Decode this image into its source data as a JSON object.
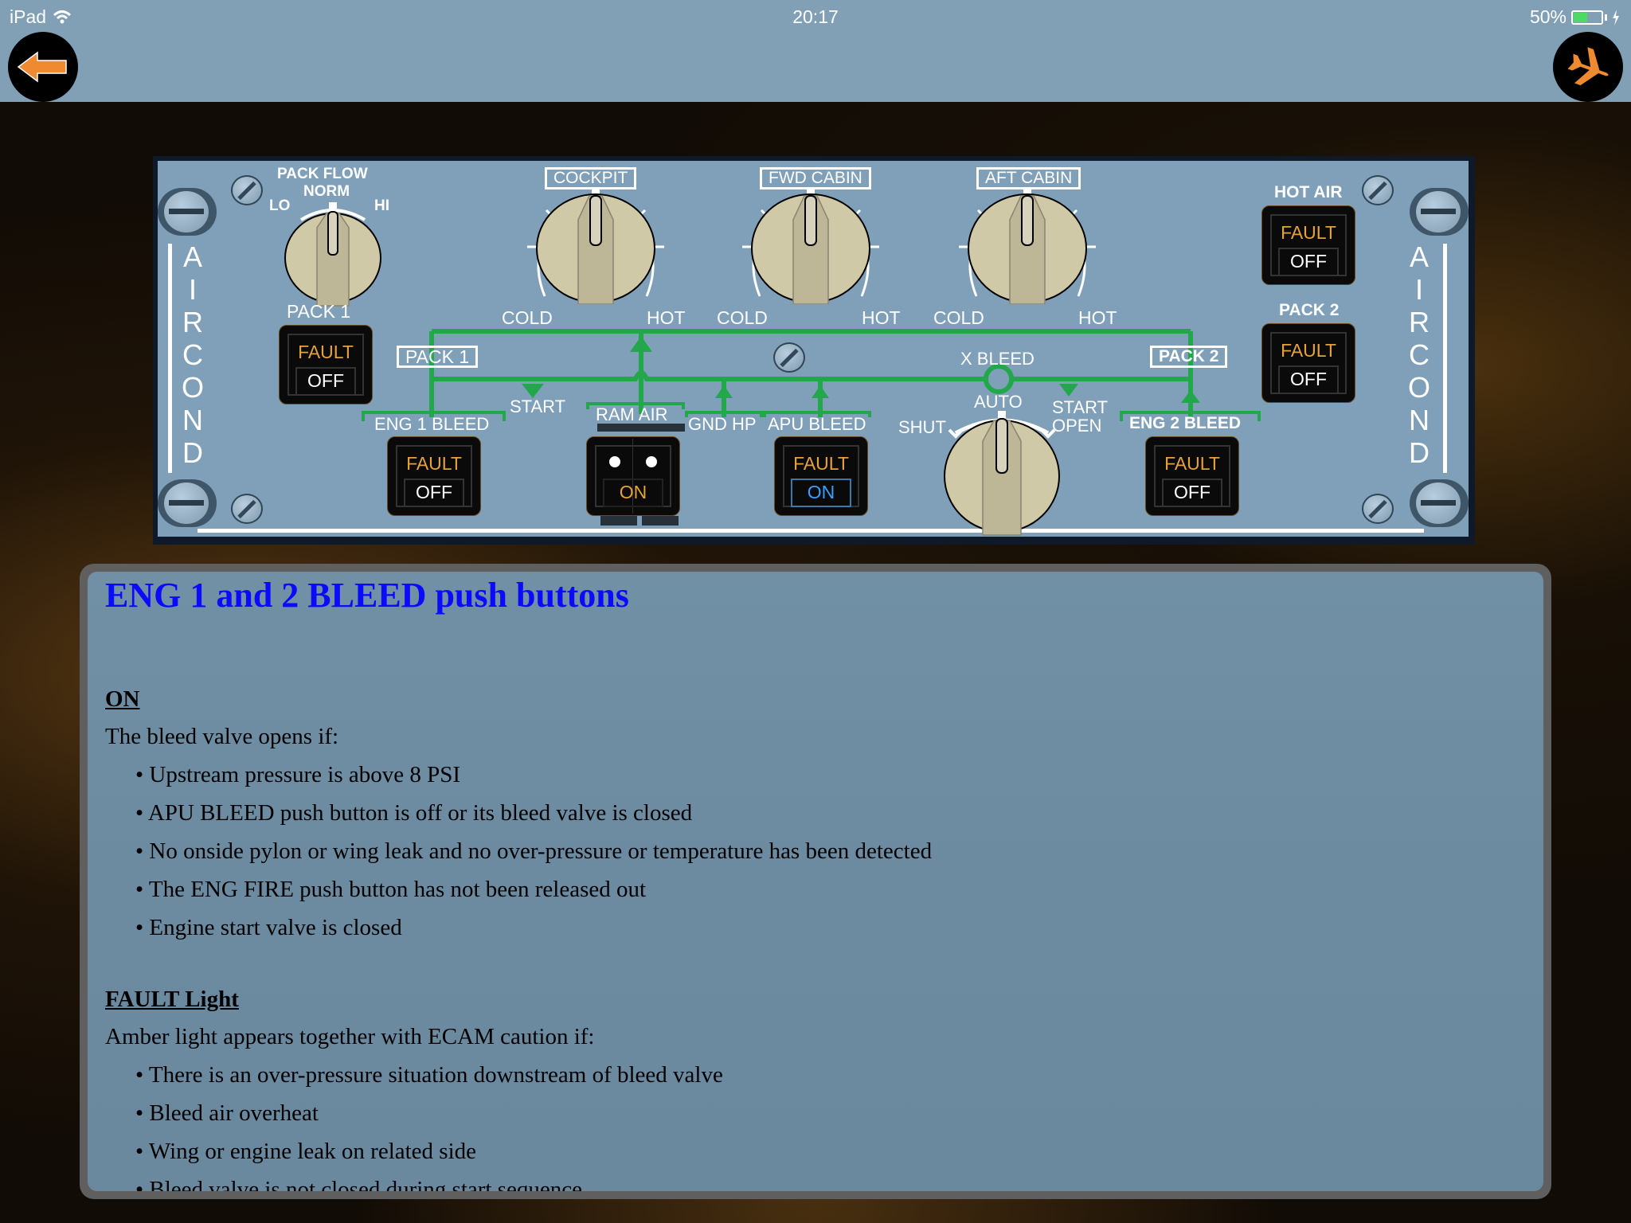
{
  "status_bar": {
    "device": "iPad",
    "time": "20:17",
    "battery": "50%",
    "battery_level": 0.5
  },
  "nav": {
    "back_icon": "back-arrow-icon",
    "home_icon": "airplane-icon"
  },
  "panel": {
    "side_label_left": [
      "A",
      "I",
      "R",
      "C",
      "O",
      "N",
      "D"
    ],
    "side_label_right": [
      "A",
      "I",
      "R",
      "C",
      "O",
      "N",
      "D"
    ],
    "pack_flow": {
      "title": "PACK FLOW",
      "norm": "NORM",
      "lo": "LO",
      "hi": "HI",
      "position": "NORM"
    },
    "pack1_label": "PACK 1",
    "pack2_label": "PACK 2",
    "hot_air_label": "HOT AIR",
    "temp_selectors": [
      {
        "label": "COCKPIT",
        "cold": "COLD",
        "hot": "HOT"
      },
      {
        "label": "FWD CABIN",
        "cold": "COLD",
        "hot": "HOT"
      },
      {
        "label": "AFT CABIN",
        "cold": "COLD",
        "hot": "HOT"
      }
    ],
    "duct_labels": {
      "pack1": "PACK 1",
      "pack2": "PACK 2",
      "start": "START",
      "ram_air": "RAM AIR",
      "gnd_hp": "GND HP",
      "apu_bleed": "APU BLEED",
      "eng1_bleed": "ENG 1 BLEED",
      "eng2_bleed": "ENG 2 BLEED",
      "x_bleed": "X BLEED"
    },
    "x_bleed_selector": {
      "shut": "SHUT",
      "auto": "AUTO",
      "open_line1": "START",
      "open_line2": "OPEN",
      "position": "AUTO"
    },
    "buttons": {
      "pack1": {
        "upper": "FAULT",
        "lower": "OFF"
      },
      "pack2": {
        "upper": "FAULT",
        "lower": "OFF"
      },
      "hot_air": {
        "upper": "FAULT",
        "lower": "OFF"
      },
      "eng1_bleed": {
        "upper": "FAULT",
        "lower": "OFF"
      },
      "eng2_bleed": {
        "upper": "FAULT",
        "lower": "OFF"
      },
      "apu_bleed": {
        "upper": "FAULT",
        "lower": "ON"
      },
      "ram_air": {
        "upper": "",
        "lower": "ON"
      }
    },
    "colors": {
      "panel": "#7fa0b8",
      "duct": "#22a84a",
      "fault": "#e6a23a",
      "on_blue": "#3aa0ff"
    }
  },
  "content": {
    "title": "ENG 1 and 2 BLEED push buttons",
    "sections": [
      {
        "heading": "ON",
        "intro": "The bleed valve opens if:",
        "bullets": [
          "Upstream pressure is above 8 PSI",
          "APU BLEED push button is off or its bleed valve is closed",
          "No onside pylon or wing leak and no over-pressure or temperature has been detected",
          "The ENG FIRE push button has not been released out",
          "Engine start valve is closed"
        ]
      },
      {
        "heading": "FAULT Light",
        "intro": "Amber light appears together with ECAM caution if:",
        "bullets": [
          "There is an over-pressure situation downstream of bleed valve",
          "Bleed air overheat",
          "Wing or engine leak on related side",
          "Bleed valve is not closed during start sequence"
        ]
      }
    ]
  }
}
